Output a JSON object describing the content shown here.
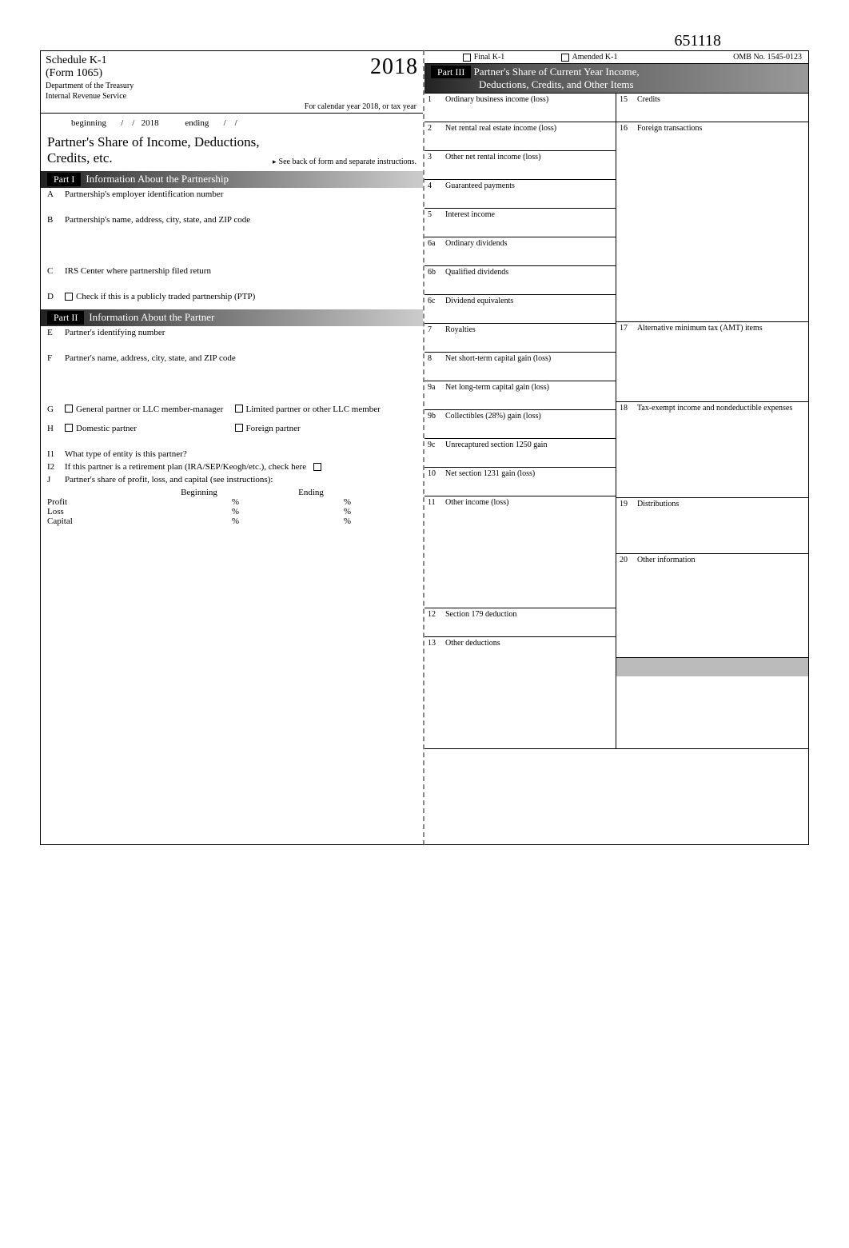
{
  "header": {
    "top_code": "651118",
    "omb": "OMB No. 1545-0123",
    "schedule": "Schedule K-1",
    "form": "(Form 1065)",
    "dept1": "Department of the Treasury",
    "dept2": "Internal Revenue Service",
    "year_prefix": "20",
    "year_suffix": "18",
    "calendar_line": "For calendar year 2018, or tax year",
    "beginning": "beginning",
    "ending": "ending",
    "fixed_year": "2018",
    "share_title": "Partner's Share of Income, Deductions,",
    "credits": "Credits, etc.",
    "see_back": "See back of form and separate instructions.",
    "final": "Final K-1",
    "amended": "Amended K-1"
  },
  "part1": {
    "label": "Part I",
    "title": "Information About the Partnership",
    "A": "Partnership's employer identification number",
    "B": "Partnership's name, address, city, state, and ZIP code",
    "C": "IRS Center where partnership filed return",
    "D": "Check if this is a publicly traded partnership (PTP)"
  },
  "part2": {
    "label": "Part II",
    "title": "Information About the Partner",
    "E": "Partner's identifying number",
    "F": "Partner's name, address, city, state, and ZIP code",
    "G_left": "General partner or LLC member-manager",
    "G_right": "Limited partner or other LLC member",
    "H_left": "Domestic partner",
    "H_right": "Foreign partner",
    "I1": "What type of entity is this partner?",
    "I2": "If this partner is a retirement plan (IRA/SEP/Keogh/etc.), check here",
    "J": "Partner's share of profit, loss, and capital (see instructions):",
    "J_begin": "Beginning",
    "J_end": "Ending",
    "J_profit": "Profit",
    "J_loss": "Loss",
    "J_capital": "Capital"
  },
  "part3": {
    "label": "Part III",
    "title1": "Partner's Share of Current Year Income,",
    "title2": "Deductions, Credits, and Other Items",
    "items_left": [
      {
        "n": "1",
        "t": "Ordinary business income (loss)"
      },
      {
        "n": "2",
        "t": "Net rental real estate income (loss)"
      },
      {
        "n": "3",
        "t": "Other net rental income (loss)"
      },
      {
        "n": "4",
        "t": "Guaranteed payments"
      },
      {
        "n": "5",
        "t": "Interest income"
      },
      {
        "n": "6a",
        "t": "Ordinary dividends"
      },
      {
        "n": "6b",
        "t": "Qualified dividends"
      },
      {
        "n": "6c",
        "t": "Dividend equivalents"
      },
      {
        "n": "7",
        "t": "Royalties"
      },
      {
        "n": "8",
        "t": "Net short-term capital gain (loss)"
      },
      {
        "n": "9a",
        "t": "Net long-term capital gain (loss)"
      },
      {
        "n": "9b",
        "t": "Collectibles (28%) gain (loss)"
      },
      {
        "n": "9c",
        "t": "Unrecaptured section 1250 gain"
      },
      {
        "n": "10",
        "t": "Net section 1231 gain (loss)"
      },
      {
        "n": "11",
        "t": "Other income (loss)"
      },
      {
        "n": "12",
        "t": "Section 179 deduction"
      },
      {
        "n": "13",
        "t": "Other deductions"
      }
    ],
    "items_right": [
      {
        "n": "15",
        "t": "Credits"
      },
      {
        "n": "16",
        "t": "Foreign transactions"
      },
      {
        "n": "17",
        "t": "Alternative minimum tax (AMT) items"
      },
      {
        "n": "18",
        "t": "Tax-exempt income and nondeductible expenses"
      },
      {
        "n": "19",
        "t": "Distributions"
      },
      {
        "n": "20",
        "t": "Other information"
      }
    ]
  },
  "pct": "%"
}
